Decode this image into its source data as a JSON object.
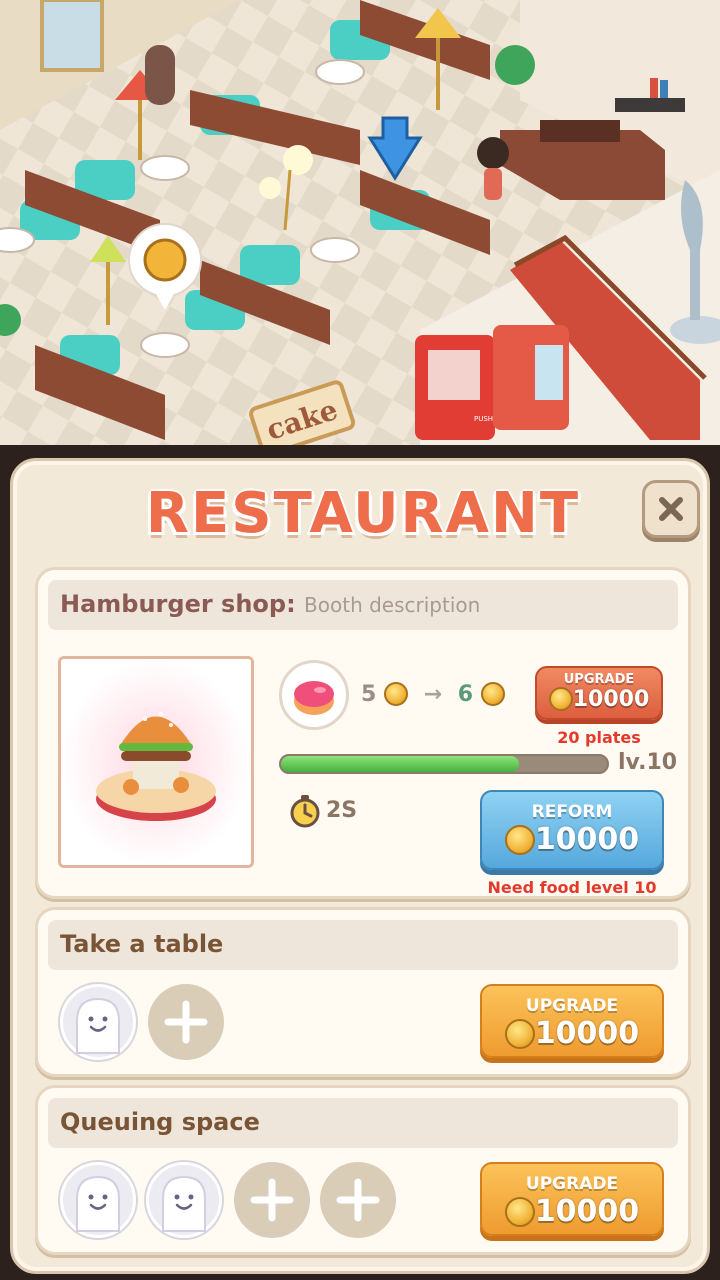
{
  "panel": {
    "title": "RESTAURANT",
    "close_icon": "close-icon"
  },
  "booth": {
    "name": "Hamburger shop:",
    "description": "Booth description",
    "earn_from": "5",
    "earn_to": "6",
    "upgrade_label": "UPGRADE",
    "upgrade_price": "10000",
    "plates_note": "20 plates",
    "progress": 0.73,
    "level": "lv.10",
    "time": "2S",
    "reform_label": "REFORM",
    "reform_price": "10000",
    "reform_note": "Need food level 10"
  },
  "tables": {
    "title": "Take a table",
    "upgrade_label": "UPGRADE",
    "upgrade_price": "10000",
    "filled_slots": 1,
    "empty_slots": 1
  },
  "queue": {
    "title": "Queuing space",
    "upgrade_label": "UPGRADE",
    "upgrade_price": "10000",
    "filled_slots": 2,
    "empty_slots": 2
  },
  "scene": {
    "sign_text": "cake",
    "vending_text": "PUSH"
  },
  "colors": {
    "title": "#ee6e4c",
    "upgrade_red": "#dd5e3e",
    "reform_blue": "#56a8dc",
    "upgrade_orange": "#ef9b2f",
    "progress_green": "#44b23c",
    "warning": "#e33a2c"
  }
}
